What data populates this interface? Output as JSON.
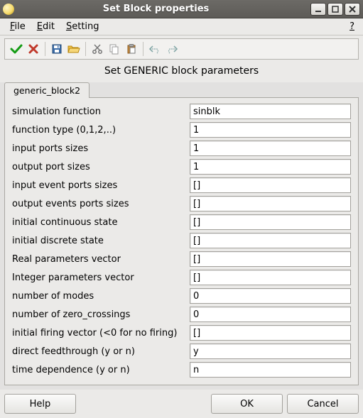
{
  "titlebar": {
    "title": "Set Block properties"
  },
  "menu": {
    "file": "File",
    "edit": "Edit",
    "setting": "Setting",
    "help_glyph": "?"
  },
  "panel_title": "Set GENERIC block parameters",
  "tab": {
    "label": "generic_block2"
  },
  "fields": {
    "sim_func": {
      "label": "simulation function",
      "value": "sinblk"
    },
    "func_type": {
      "label": "function type (0,1,2,..)",
      "value": "1"
    },
    "in_ports": {
      "label": "input ports sizes",
      "value": "1"
    },
    "out_ports": {
      "label": "output port sizes",
      "value": "1"
    },
    "in_ev_ports": {
      "label": "input event ports sizes",
      "value": "[]"
    },
    "out_ev_ports": {
      "label": "output events ports sizes",
      "value": "[]"
    },
    "init_cont": {
      "label": "initial continuous state",
      "value": "[]"
    },
    "init_disc": {
      "label": "initial discrete state",
      "value": "[]"
    },
    "real_params": {
      "label": "Real parameters vector",
      "value": "[]"
    },
    "int_params": {
      "label": "Integer parameters vector",
      "value": "[]"
    },
    "num_modes": {
      "label": "number of modes",
      "value": "0"
    },
    "num_zc": {
      "label": "number of zero_crossings",
      "value": "0"
    },
    "init_firing": {
      "label": "initial firing vector (<0 for no firing)",
      "value": "[]"
    },
    "direct_feed": {
      "label": "direct feedthrough (y or n)",
      "value": "y"
    },
    "time_dep": {
      "label": "time dependence (y or n)",
      "value": "n"
    }
  },
  "buttons": {
    "help": "Help",
    "ok": "OK",
    "cancel": "Cancel"
  }
}
